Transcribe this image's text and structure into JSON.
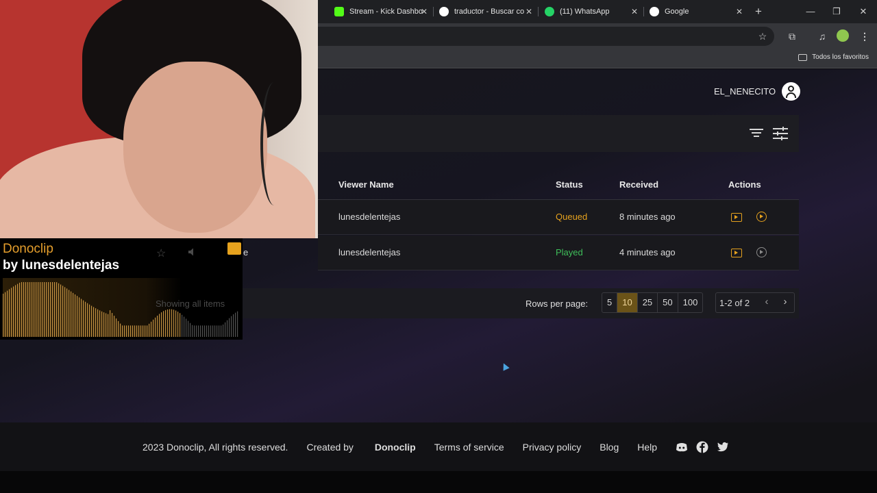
{
  "browser": {
    "tabs": [
      {
        "title": "Stream - Kick Dashbo",
        "favicon": "kick-icon",
        "color": "#53fc18"
      },
      {
        "title": "traductor - Buscar co",
        "favicon": "google-icon",
        "color": "#ffffff"
      },
      {
        "title": "(11) WhatsApp",
        "favicon": "whatsapp-icon",
        "color": "#25d366"
      },
      {
        "title": "Google",
        "favicon": "google-icon",
        "color": "#ffffff"
      }
    ],
    "new_tab": "+",
    "bookmarks_folder": "Todos los favoritos"
  },
  "header": {
    "username": "EL_NENECITO"
  },
  "table": {
    "columns": [
      "Viewer Name",
      "Status",
      "Received",
      "Actions"
    ],
    "rows": [
      {
        "viewer": "lunesdelentejas",
        "status": "Queued",
        "status_color": "#e6a21e",
        "received": "8 minutes ago"
      },
      {
        "viewer": "lunesdelentejas",
        "status": "Played",
        "status_color": "#3fbf5a",
        "received": "4 minutes ago"
      }
    ]
  },
  "pagination": {
    "rows_label": "Rows per page:",
    "options": [
      "5",
      "10",
      "25",
      "50",
      "100"
    ],
    "selected": "10",
    "range": "1-2 of 2"
  },
  "footer": {
    "copyright": "2023 Donoclip, All rights reserved.",
    "created_prefix": "Created by",
    "created_brand": "Donoclip",
    "links": [
      "Terms of service",
      "Privacy policy",
      "Blog",
      "Help"
    ]
  },
  "alert": {
    "title": "Donoclip",
    "by_prefix": "by",
    "by_user": "lunesdelentejas",
    "partial_text": "e",
    "faded_text": "Showing all items",
    "accent": "#e59e2c"
  }
}
